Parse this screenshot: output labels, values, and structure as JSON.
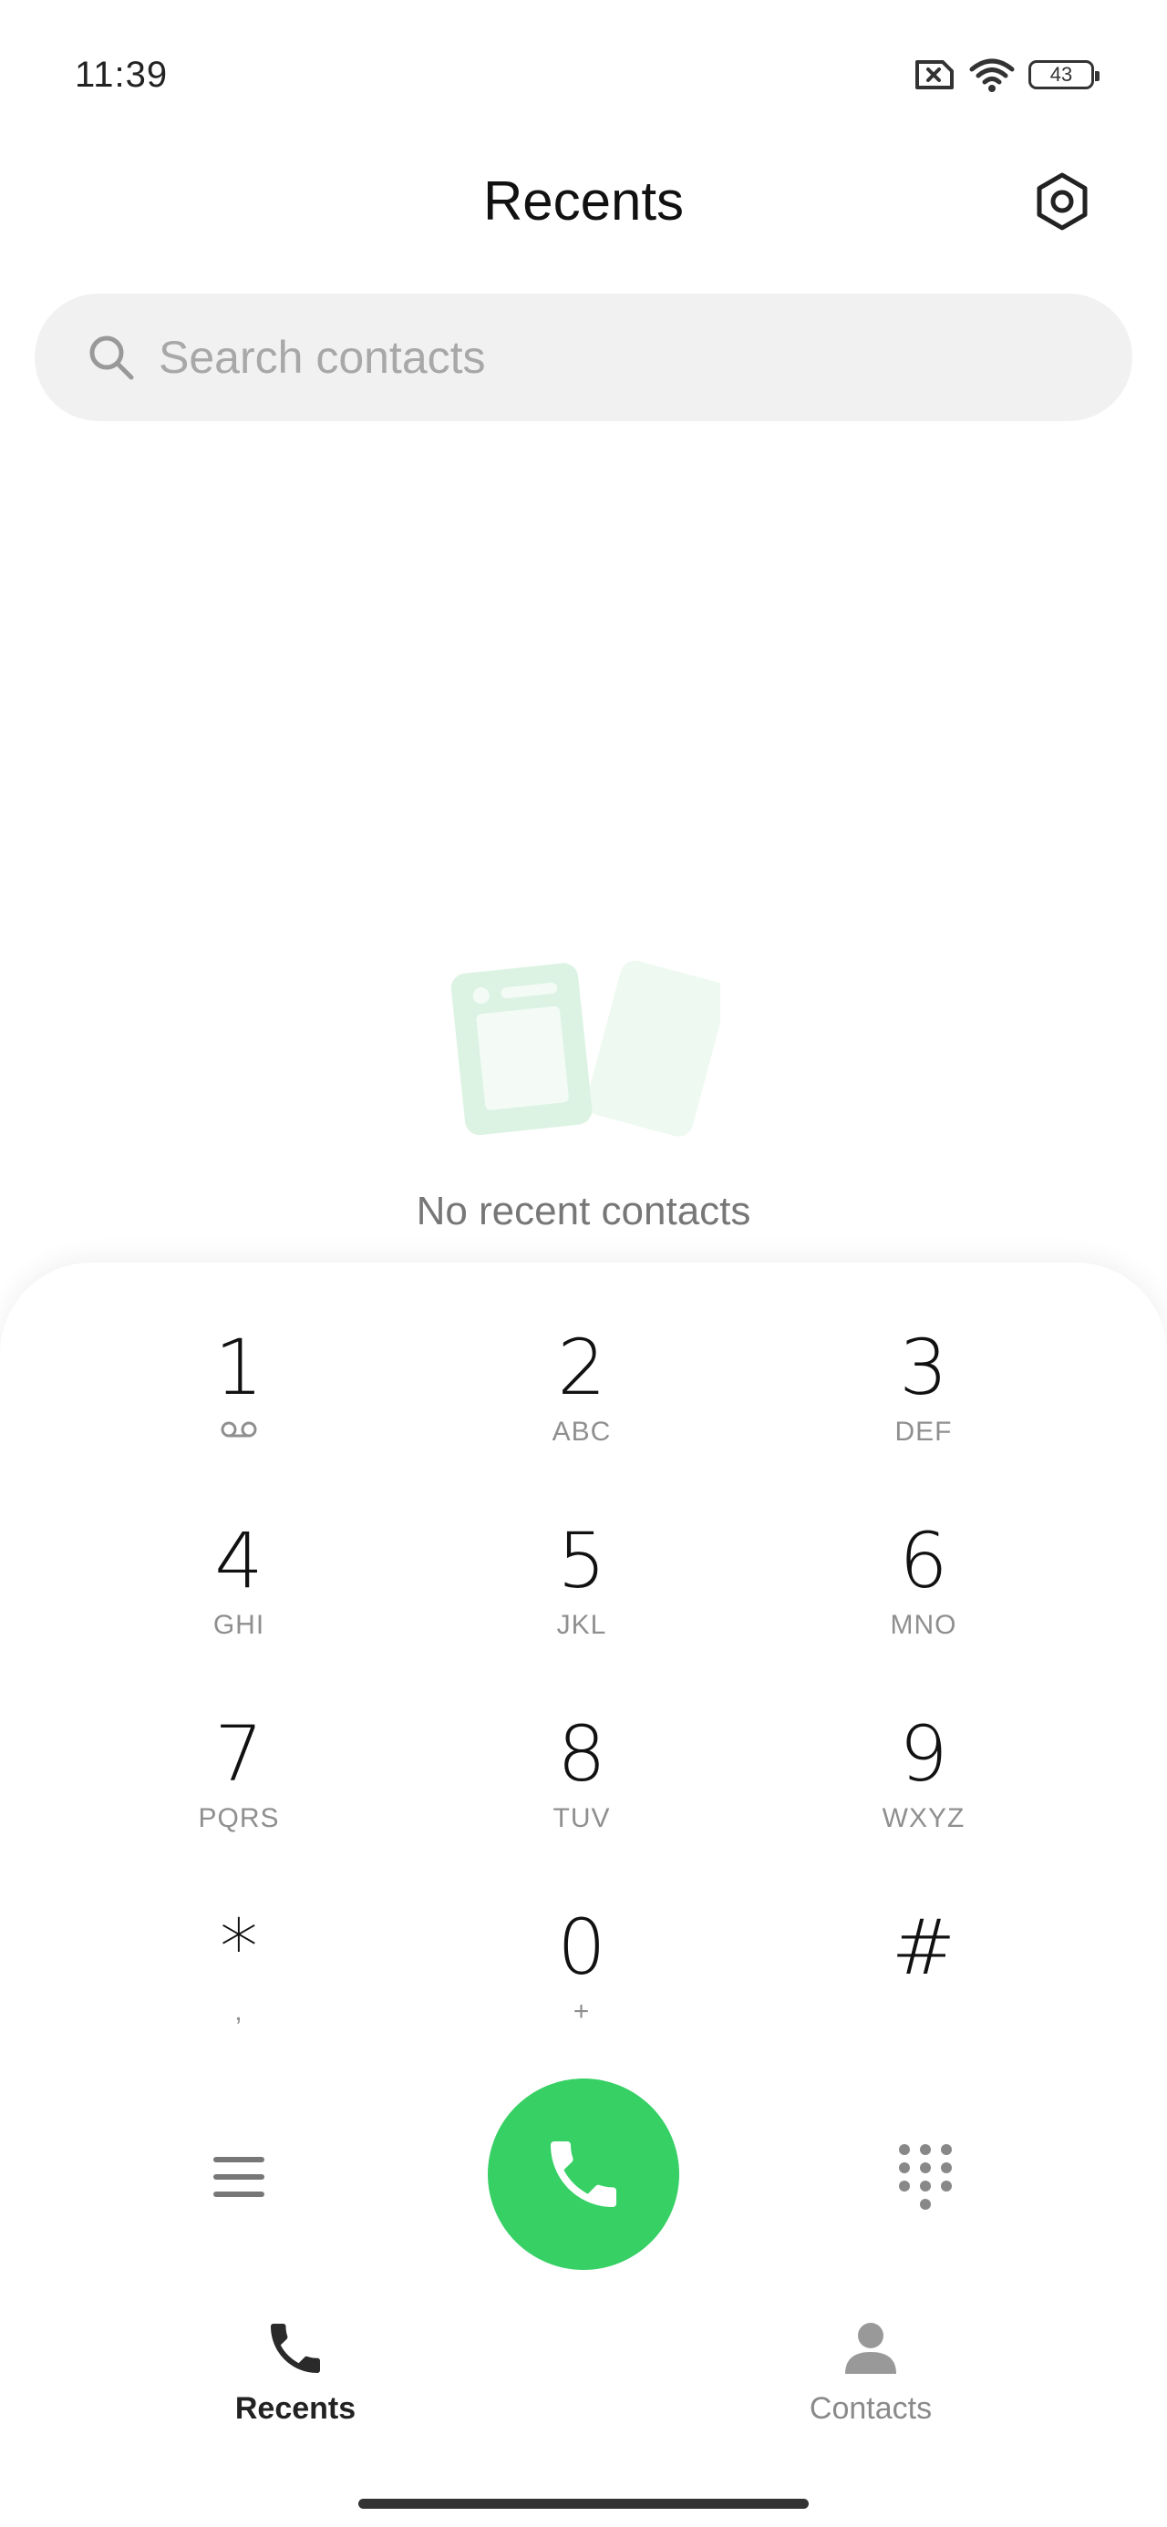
{
  "status_bar": {
    "time": "11:39",
    "battery": "43",
    "icons": [
      "sim-blocked-icon",
      "wifi-icon",
      "battery-icon"
    ]
  },
  "header": {
    "title": "Recents",
    "settings_icon": "settings-icon"
  },
  "search": {
    "placeholder": "Search contacts",
    "icon": "search-icon"
  },
  "empty_state": {
    "message": "No recent contacts",
    "illustration": "empty-cards-illustration"
  },
  "dialpad": {
    "keys": [
      {
        "digit": "1",
        "letters": ""
      },
      {
        "digit": "2",
        "letters": "ABC"
      },
      {
        "digit": "3",
        "letters": "DEF"
      },
      {
        "digit": "4",
        "letters": "GHI"
      },
      {
        "digit": "5",
        "letters": "JKL"
      },
      {
        "digit": "6",
        "letters": "MNO"
      },
      {
        "digit": "7",
        "letters": "PQRS"
      },
      {
        "digit": "8",
        "letters": "TUV"
      },
      {
        "digit": "9",
        "letters": "WXYZ"
      },
      {
        "digit": "*",
        "letters": ","
      },
      {
        "digit": "0",
        "letters": "+"
      },
      {
        "digit": "#",
        "letters": ""
      }
    ],
    "voicemail_icon": "voicemail-icon"
  },
  "actions": {
    "menu_icon": "menu-icon",
    "call_icon": "phone-icon",
    "dialpad_icon": "dialpad-icon",
    "call_color": "#37d065"
  },
  "bottom_nav": {
    "tabs": [
      {
        "label": "Recents",
        "icon": "phone-icon",
        "active": true
      },
      {
        "label": "Contacts",
        "icon": "person-icon",
        "active": false
      }
    ]
  }
}
